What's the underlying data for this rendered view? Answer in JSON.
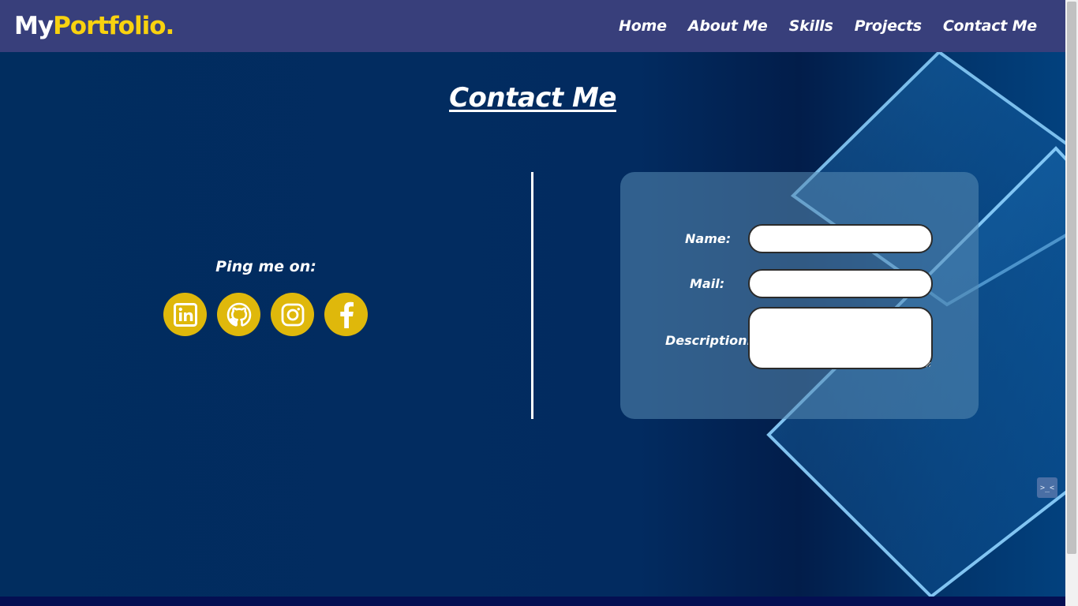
{
  "brand": {
    "part1": "My",
    "part2": "Portfolio."
  },
  "nav": {
    "home": "Home",
    "about": "About Me",
    "skills": "Skills",
    "projects": "Projects",
    "contact": "Contact Me"
  },
  "section": {
    "title": "Contact Me"
  },
  "left_panel": {
    "ping_label": "Ping me on:",
    "socials": [
      {
        "name": "linkedin-icon"
      },
      {
        "name": "github-icon"
      },
      {
        "name": "instagram-icon"
      },
      {
        "name": "facebook-icon"
      }
    ]
  },
  "form": {
    "name_label": "Name:",
    "mail_label": "Mail:",
    "description_label": "Description:",
    "name_value": "",
    "mail_value": "",
    "description_value": ""
  },
  "widget": {
    "glyph": ">_<"
  },
  "colors": {
    "navbar": "#383f7b",
    "brand_accent": "#f8d20f",
    "social_bg": "#dfb80b",
    "main_bg": "#022a5c"
  }
}
